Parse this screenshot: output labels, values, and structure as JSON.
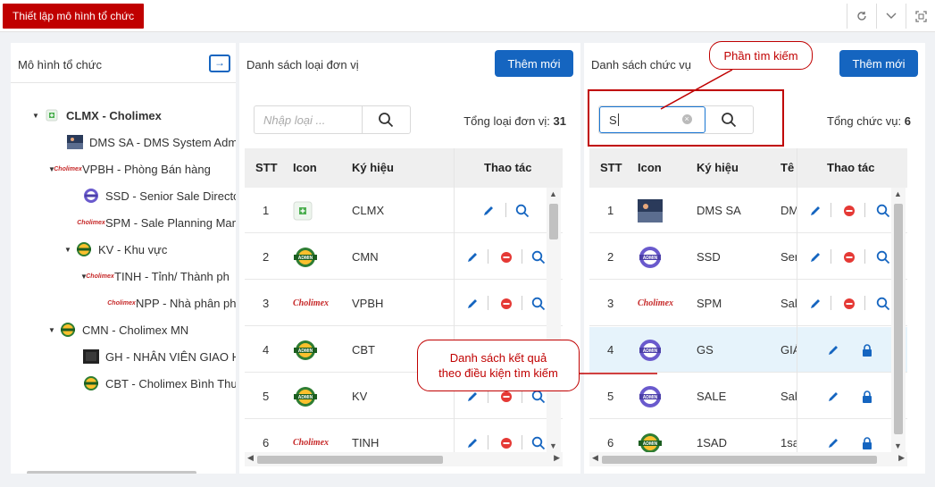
{
  "title": "Thiết lập mô hình tổ chức",
  "top_icons": [
    "refresh-icon",
    "chevron-down-icon",
    "fullscreen-icon"
  ],
  "left": {
    "title": "Mô hình tổ chức",
    "tree": [
      {
        "label": "CLMX - Cholimex",
        "bold": true
      },
      {
        "label": "DMS SA - DMS System Adm"
      },
      {
        "label": "VPBH - Phòng Bán hàng"
      },
      {
        "label": "SSD - Senior Sale Director"
      },
      {
        "label": "SPM - Sale Planning Man"
      },
      {
        "label": "KV - Khu vực"
      },
      {
        "label": "TINH - Tỉnh/ Thành ph"
      },
      {
        "label": "NPP - Nhà phân ph"
      },
      {
        "label": "CMN - Cholimex MN"
      },
      {
        "label": "GH - NHÂN VIÊN GIAO H"
      },
      {
        "label": "CBT - Cholimex Bình Thuậ"
      }
    ]
  },
  "mid": {
    "title": "Danh sách loại đơn vị",
    "add_label": "Thêm mới",
    "search_placeholder": "Nhập loại ...",
    "total_label": "Tổng loại đơn vị:",
    "total_value": "31",
    "columns": [
      "STT",
      "Icon",
      "Ký hiệu",
      "Thao tác"
    ],
    "rows": [
      {
        "stt": "1",
        "code": "CLMX"
      },
      {
        "stt": "2",
        "code": "CMN"
      },
      {
        "stt": "3",
        "code": "VPBH"
      },
      {
        "stt": "4",
        "code": "CBT"
      },
      {
        "stt": "5",
        "code": "KV"
      },
      {
        "stt": "6",
        "code": "TINH"
      }
    ]
  },
  "right": {
    "title": "Danh sách chức vụ",
    "add_label": "Thêm mới",
    "search_value": "S",
    "total_label": "Tổng chức vụ:",
    "total_value": "6",
    "columns": [
      "STT",
      "Icon",
      "Ký hiệu",
      "Tê",
      "Thao tác"
    ],
    "rows": [
      {
        "stt": "1",
        "code": "DMS SA",
        "name": "DM"
      },
      {
        "stt": "2",
        "code": "SSD",
        "name": "Sen"
      },
      {
        "stt": "3",
        "code": "SPM",
        "name": "Sale"
      },
      {
        "stt": "4",
        "code": "GS",
        "name": "GIÁ"
      },
      {
        "stt": "5",
        "code": "SALE",
        "name": "Sale"
      },
      {
        "stt": "6",
        "code": "1SAD",
        "name": "1sa"
      }
    ]
  },
  "annotations": {
    "search_callout": "Phần tìm kiếm",
    "result_callout_line1": "Danh sách kết quả",
    "result_callout_line2": "theo điều kiện tìm kiếm"
  },
  "colors": {
    "brand_red": "#c00000",
    "primary_blue": "#1565c0",
    "selected_row": "#e6f3fb"
  }
}
